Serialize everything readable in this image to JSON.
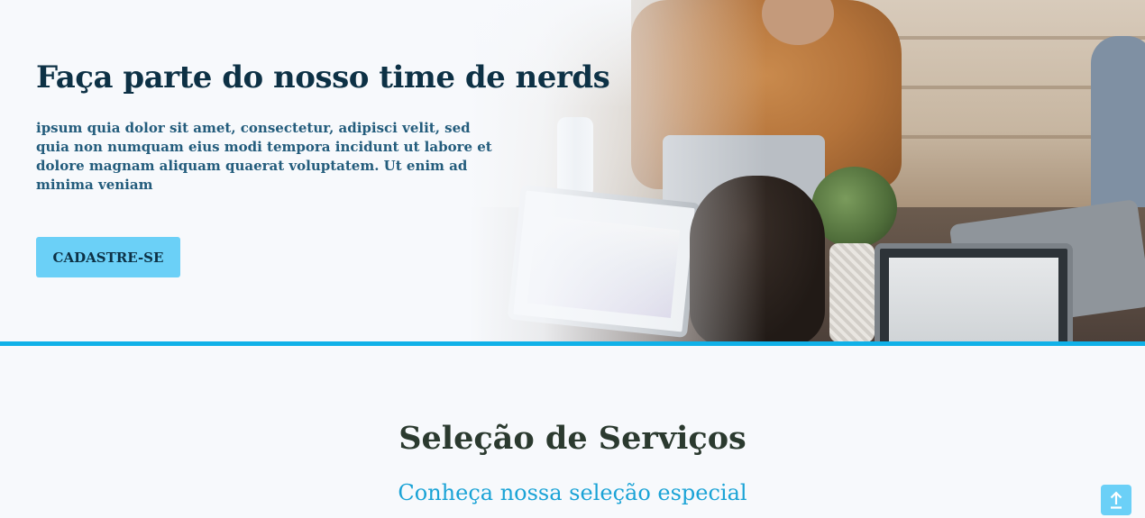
{
  "hero": {
    "title": "Faça parte do nosso time de nerds",
    "text": "ipsum quia dolor sit amet, consectetur, adipisci velit, sed quia non numquam eius modi tempora incidunt ut labore et dolore magnam aliquam quaerat voluptatem. Ut enim ad minima veniam",
    "cta_label": "CADASTRE-SE"
  },
  "services": {
    "title": "Seleção de Serviços",
    "subtitle": "Conheça nossa seleção especial"
  },
  "scroll_top": {
    "icon": "arrow-up-icon"
  },
  "colors": {
    "primary_dark": "#0d3145",
    "text_blue": "#235c7c",
    "cta": "#6bd0f7",
    "divider": "#10b1e8",
    "subtitle": "#1aa3d6",
    "background": "#f7f9fc"
  }
}
